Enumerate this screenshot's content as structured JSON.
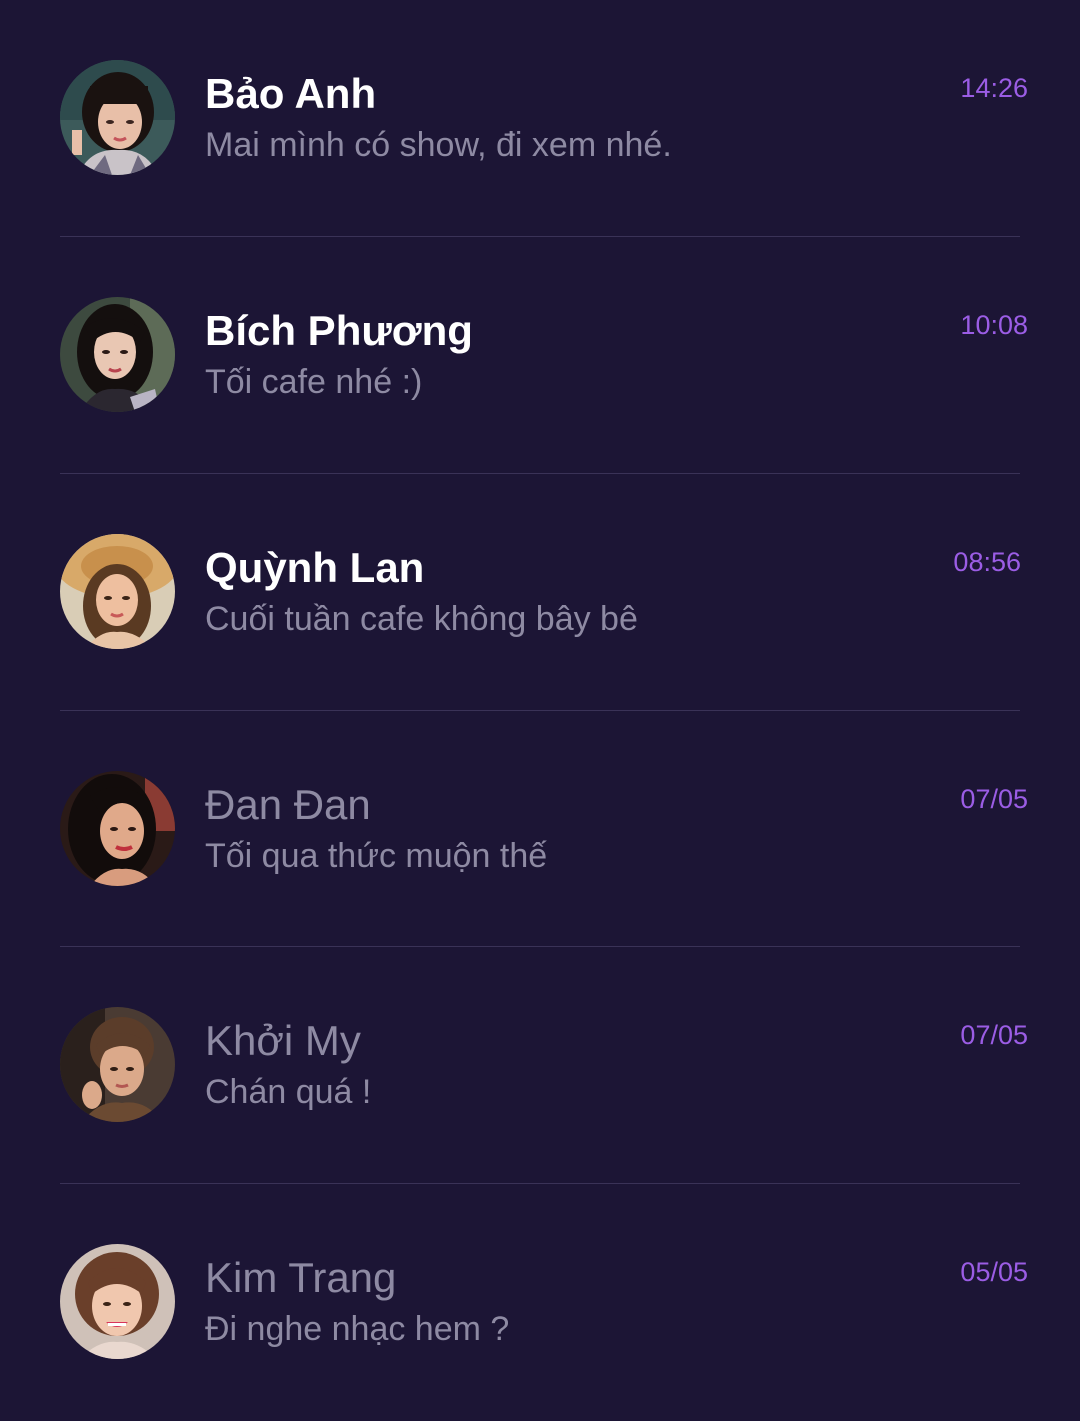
{
  "colors": {
    "background": "#1c1535",
    "divider": "#3a3257",
    "name_unread": "#ffffff",
    "name_read": "#8e8aa3",
    "preview": "#8e8aa3",
    "timestamp": "#9b5de5"
  },
  "chats": [
    {
      "name": "Bảo Anh",
      "message": "Mai mình có show, đi xem nhé.",
      "time": "14:26",
      "unread": true,
      "avatar": "avatar-bao-anh"
    },
    {
      "name": "Bích Phương",
      "message": "Tối cafe nhé :)",
      "time": "10:08",
      "unread": true,
      "avatar": "avatar-bich-phuong"
    },
    {
      "name": "Quỳnh Lan",
      "message": "Cuối tuần cafe không bây bê",
      "time": "08:56",
      "unread": true,
      "avatar": "avatar-quynh-lan"
    },
    {
      "name": "Đan Đan",
      "message": "Tối qua thức muộn thế",
      "time": "07/05",
      "unread": false,
      "avatar": "avatar-dan-dan"
    },
    {
      "name": "Khởi My",
      "message": "Chán quá !",
      "time": "07/05",
      "unread": false,
      "avatar": "avatar-khoi-my"
    },
    {
      "name": "Kim Trang",
      "message": "Đi nghe nhạc hem ?",
      "time": "05/05",
      "unread": false,
      "avatar": "avatar-kim-trang"
    }
  ]
}
